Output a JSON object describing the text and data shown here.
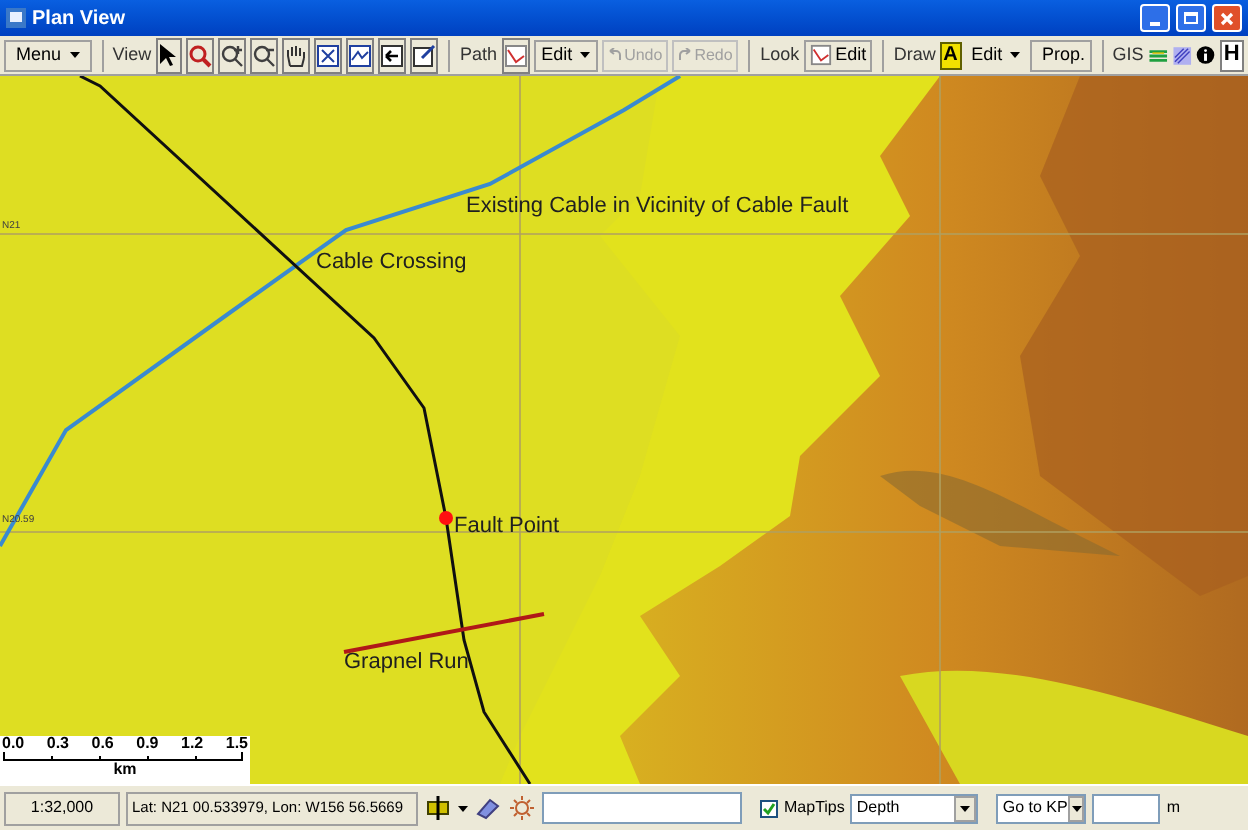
{
  "window": {
    "title": "Plan View"
  },
  "toolbar": {
    "menu": {
      "label": "Menu"
    },
    "groups": [
      {
        "label": "View"
      },
      {
        "label": "Path"
      },
      {
        "label": "Look"
      },
      {
        "label": "Draw"
      },
      {
        "label": "GIS"
      }
    ],
    "path_edit": {
      "label": "Edit"
    },
    "undo": {
      "label": "Undo",
      "disabled": true
    },
    "redo": {
      "label": "Redo",
      "disabled": true
    },
    "look_edit": {
      "label": "Edit"
    },
    "draw_edit": {
      "label": "Edit"
    },
    "draw_text": {
      "label": "A"
    },
    "prop": {
      "label": "Prop."
    },
    "help": {
      "label": "H"
    }
  },
  "map": {
    "labels": [
      {
        "text": "Existing Cable in Vicinity of Cable Fault",
        "kind": "cable"
      },
      {
        "text": "Cable Crossing",
        "kind": "crossing"
      },
      {
        "text": "Fault Point",
        "kind": "fault"
      },
      {
        "text": "Grapnel Run",
        "kind": "grapnel"
      }
    ],
    "grid_labels": [
      "N21",
      "N20.59"
    ],
    "scale_bar": {
      "ticks": [
        "0.0",
        "0.3",
        "0.6",
        "0.9",
        "1.2",
        "1.5"
      ],
      "unit": "km"
    }
  },
  "status_bar": {
    "scale": "1:32,000",
    "position": "Lat: N21 00.533979, Lon: W156 56.5669",
    "maptips": {
      "label": "MapTips",
      "checked": true
    },
    "depth": "Depth",
    "goto": "Go to KP",
    "unit": "m"
  }
}
